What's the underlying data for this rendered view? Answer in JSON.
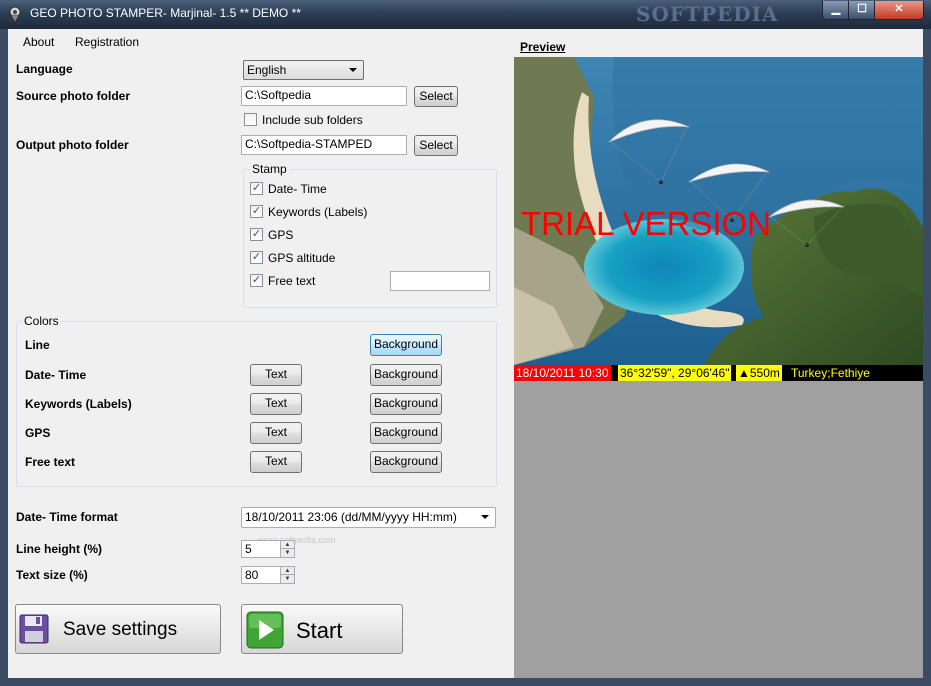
{
  "window": {
    "title": "GEO PHOTO STAMPER- Marjinal- 1.5 ** DEMO **",
    "watermark": "SOFTPEDIA",
    "controls": {
      "minimize": "▁",
      "maximize": "☐",
      "close": "✕"
    }
  },
  "menu": {
    "items": [
      "About",
      "Registration"
    ]
  },
  "form": {
    "language": {
      "label": "Language",
      "value": "English"
    },
    "source": {
      "label": "Source photo folder",
      "value": "C:\\Softpedia",
      "button": "Select"
    },
    "subfolders": {
      "label": "Include sub folders",
      "checked": false
    },
    "output": {
      "label": "Output photo folder",
      "value": "C:\\Softpedia-STAMPED",
      "button": "Select"
    },
    "stamp": {
      "title": "Stamp",
      "items": [
        {
          "label": "Date- Time",
          "checked": true
        },
        {
          "label": "Keywords (Labels)",
          "checked": true
        },
        {
          "label": "GPS",
          "checked": true
        },
        {
          "label": "GPS altitude",
          "checked": true
        },
        {
          "label": "Free text",
          "checked": true
        }
      ],
      "free_text_value": ""
    },
    "colors": {
      "title": "Colors",
      "rows": [
        {
          "label": "Line",
          "text_button": "",
          "bg_button": "Background"
        },
        {
          "label": "Date- Time",
          "text_button": "Text",
          "bg_button": "Background"
        },
        {
          "label": "Keywords (Labels)",
          "text_button": "Text",
          "bg_button": "Background"
        },
        {
          "label": "GPS",
          "text_button": "Text",
          "bg_button": "Background"
        },
        {
          "label": "Free text",
          "text_button": "Text",
          "bg_button": "Background"
        }
      ]
    },
    "datetime_format": {
      "label": "Date- Time format",
      "value": "18/10/2011 23:06 (dd/MM/yyyy HH:mm)",
      "watermark": "www.softpedia.com"
    },
    "line_height": {
      "label": "Line height  (%)",
      "value": "5"
    },
    "text_size": {
      "label": "Text size  (%)",
      "value": "80"
    },
    "save_button": "Save settings",
    "start_button": "Start"
  },
  "preview": {
    "label": "Preview",
    "overlay": "TRIAL VERSION",
    "stamp": {
      "datetime": "18/10/2011 10:30",
      "gps": "36°32'59\",  29°06'46\"",
      "altitude": "▲550m",
      "keywords": "Turkey;Fethiye"
    }
  },
  "colors": {
    "datetime_bg": "#ff0000",
    "gps_bg": "#ffff00",
    "stamp_bar_bg": "#000000",
    "keywords_text": "#ffff00",
    "overlay_text": "#ff0000"
  }
}
